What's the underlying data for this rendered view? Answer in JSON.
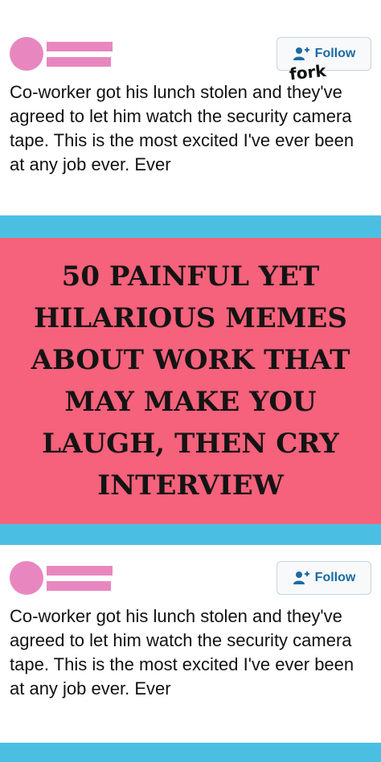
{
  "post_top": {
    "follow_label": "Follow",
    "text": "Co-worker got his lunch stolen and they've agreed to let him watch the security camera tape. This is the most excited I've ever been at any job ever. Ever",
    "watermark": "fork"
  },
  "banner": {
    "headline": "50 Painful Yet Hilarious Memes About Work That May Make You Laugh, Then Cry Interview"
  },
  "post_bottom": {
    "follow_label": "Follow",
    "text": "Co-worker got his lunch stolen and they've agreed to let him watch the security camera tape. This is the most excited I've ever been at any job ever. Ever"
  },
  "colors": {
    "background": "#4bbfe2",
    "banner": "#f6617b",
    "placeholder_pink": "#e887bf",
    "follow_text": "#1b6aa3"
  },
  "icons": {
    "follow": "add-user-icon"
  }
}
